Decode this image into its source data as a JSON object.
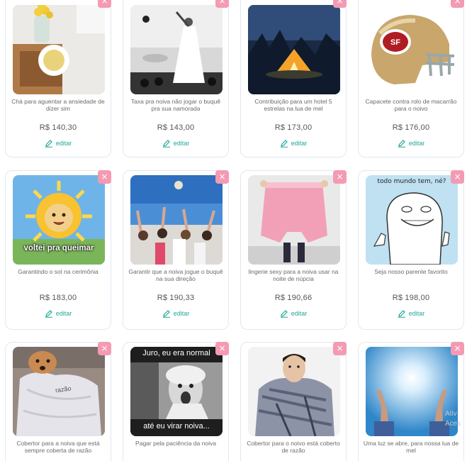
{
  "products": [
    {
      "title": "Chá para aguentar a ansiedade de dizer sim",
      "price": "R$ 140,30",
      "edit_label": "editar",
      "icon": "tea-image"
    },
    {
      "title": "Taxa pra noiva não jogar o buquê pra sua namorada",
      "price": "R$ 143,00",
      "edit_label": "editar",
      "icon": "bride-image"
    },
    {
      "title": "Contribuição para um hotel 5 estrelas na lua de mel",
      "price": "R$ 173,00",
      "edit_label": "editar",
      "icon": "tent-image"
    },
    {
      "title": "Capacete contra rolo de macarrão para o noivo",
      "price": "R$ 176,00",
      "edit_label": "editar",
      "icon": "helmet-image"
    },
    {
      "title": "Garantindo o sol na cerimônia",
      "price": "R$ 183,00",
      "edit_label": "editar",
      "icon": "sun-image",
      "caption": "voltei pra queimar"
    },
    {
      "title": "Garantir que a noiva jogue o buquê na sua direção",
      "price": "R$ 190,33",
      "edit_label": "editar",
      "icon": "bouquet-image"
    },
    {
      "title": "lingerie sexy para a noiva usar na noite de núpcia",
      "price": "R$ 190,66",
      "edit_label": "editar",
      "icon": "lingerie-image"
    },
    {
      "title": "Seja nosso parente favorito",
      "price": "R$ 198,00",
      "edit_label": "editar",
      "icon": "meme-image",
      "caption": "todo mundo tem, né?"
    },
    {
      "title": "Cobertor para a noiva que está sempre coberta de razão",
      "price": "",
      "edit_label": "",
      "icon": "dog-blanket-image",
      "caption": "razão"
    },
    {
      "title": "Pagar pela paciência da noiva",
      "price": "",
      "edit_label": "",
      "icon": "screaming-bride-image",
      "caption_top": "Juro, eu era normal",
      "caption_bottom": "até eu virar noiva..."
    },
    {
      "title": "Cobertor para o noivo está coberto de razão",
      "price": "",
      "edit_label": "",
      "icon": "man-blanket-image"
    },
    {
      "title": "Uma luz se abre, para nossa lua de mel",
      "price": "",
      "edit_label": "",
      "icon": "light-image"
    }
  ],
  "close_symbol": "×",
  "watermark": "Ativ Aces",
  "colors": {
    "accent": "#20a898",
    "close": "#f49ab2",
    "border": "#dfe9f1"
  }
}
